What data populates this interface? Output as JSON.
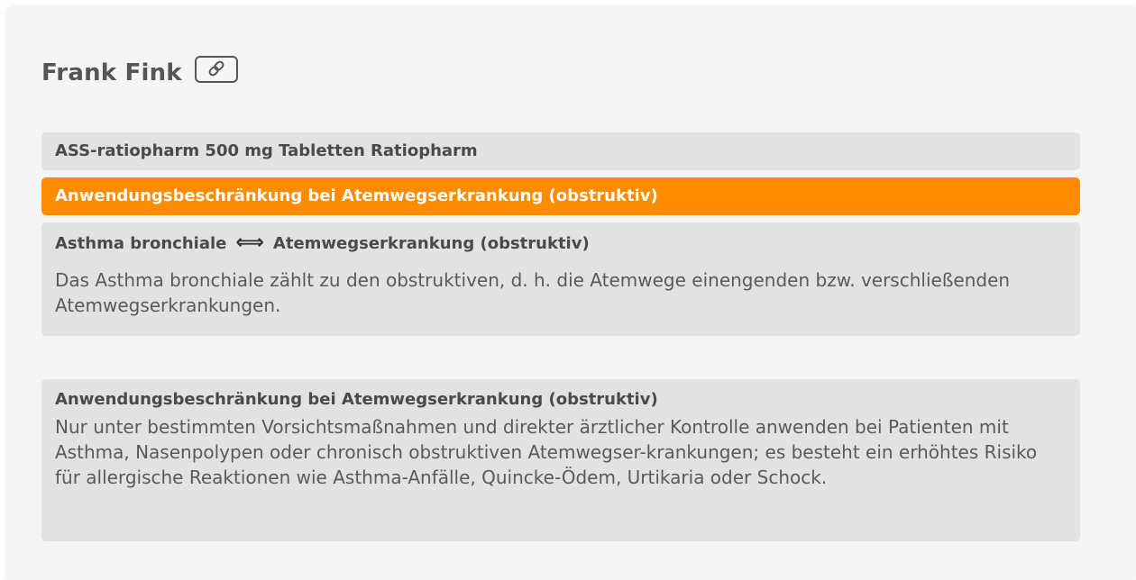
{
  "patient": {
    "name": "Frank Fink"
  },
  "product": {
    "label": "ASS-ratiopharm 500 mg Tabletten Ratiopharm"
  },
  "warning": {
    "label": "Anwendungsbeschränkung bei Atemwegserkrankung (obstruktiv)",
    "color": "#ff8c00"
  },
  "interaction": {
    "left": "Asthma bronchiale",
    "arrow": "⟺",
    "right": "Atemwegserkrankung (obstruktiv)",
    "text": "Das Asthma bronchiale zählt zu den obstruktiven, d. h. die Atemwege einengenden bzw. verschließenden Atemwegserkrankungen."
  },
  "restriction": {
    "title": "Anwendungsbeschränkung bei Atemwegserkrankung (obstruktiv)",
    "text": "Nur unter bestimmten Vorsichtsmaßnahmen und direkter ärztlicher Kontrolle anwenden bei Patienten mit Asthma, Nasenpolypen oder chronisch obstruktiven Atemwegser-krankungen; es besteht ein erhöhtes Risiko für allergische Reaktionen wie Asthma-Anfälle, Quincke-Ödem, Urtikaria oder Schock."
  },
  "icons": {
    "link": "link-icon"
  }
}
